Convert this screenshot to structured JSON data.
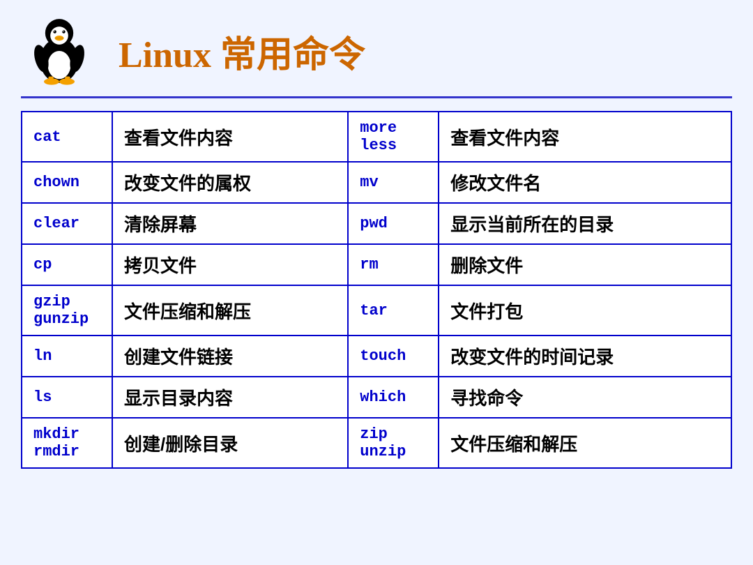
{
  "header": {
    "title_latin": "Linux",
    "title_cn": "常用命令"
  },
  "table": {
    "rows": [
      {
        "cmd1": "cat",
        "desc1": "查看文件内容",
        "cmd2": "more\nless",
        "desc2": "查看文件内容"
      },
      {
        "cmd1": "chown",
        "desc1": "改变文件的属权",
        "cmd2": "mv",
        "desc2": "修改文件名"
      },
      {
        "cmd1": "clear",
        "desc1": "清除屏幕",
        "cmd2": "pwd",
        "desc2": "显示当前所在的目录"
      },
      {
        "cmd1": "cp",
        "desc1": "拷贝文件",
        "cmd2": "rm",
        "desc2": "删除文件"
      },
      {
        "cmd1": "gzip\ngunzip",
        "desc1": "文件压缩和解压",
        "cmd2": "tar",
        "desc2": "文件打包"
      },
      {
        "cmd1": "ln",
        "desc1": "创建文件链接",
        "cmd2": "touch",
        "desc2": "改变文件的时间记录"
      },
      {
        "cmd1": "ls",
        "desc1": "显示目录内容",
        "cmd2": "which",
        "desc2": "寻找命令"
      },
      {
        "cmd1": "mkdir\nrmdir",
        "desc1": "创建/删除目录",
        "cmd2": "zip\nunzip",
        "desc2": "文件压缩和解压"
      }
    ]
  }
}
